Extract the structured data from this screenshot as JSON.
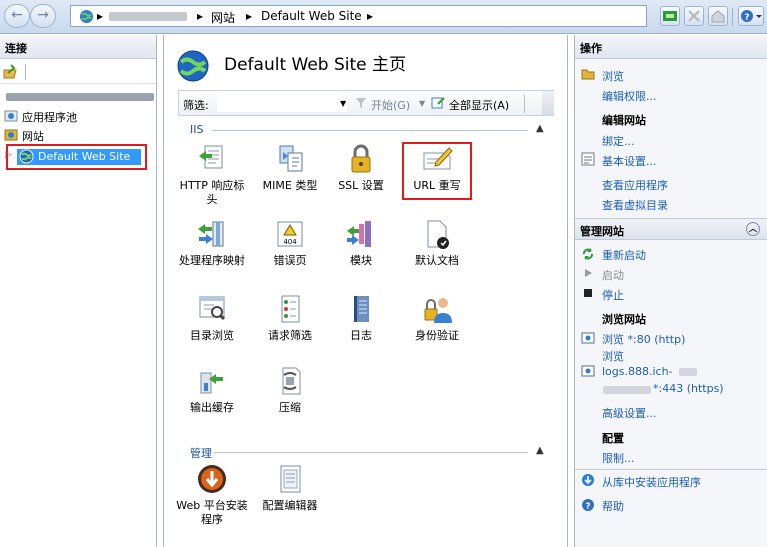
{
  "topbar": {
    "back": "←",
    "forward": "→",
    "breadcrumb": [
      {
        "label": "网站"
      },
      {
        "label": "Default Web Site"
      }
    ],
    "sep": "▸",
    "help_label": "?"
  },
  "left": {
    "header": "连接",
    "tree": {
      "app_pools": "应用程序池",
      "sites": "网站",
      "default_site": "Default Web Site"
    }
  },
  "center": {
    "title": "Default Web Site 主页",
    "filter": {
      "label": "筛选:",
      "placeholder": "",
      "go": "开始(G)",
      "show_all": "全部显示(A)"
    },
    "groups": [
      {
        "title": "IIS",
        "features": [
          {
            "label": "HTTP 响应标头",
            "icon": "http-headers-icon"
          },
          {
            "label": "MIME 类型",
            "icon": "mime-types-icon"
          },
          {
            "label": "SSL 设置",
            "icon": "lock-icon"
          },
          {
            "label": "URL 重写",
            "icon": "url-rewrite-icon"
          },
          {
            "label": "处理程序映射",
            "icon": "handler-mappings-icon"
          },
          {
            "label": "错误页",
            "icon": "error-pages-icon"
          },
          {
            "label": "模块",
            "icon": "modules-icon"
          },
          {
            "label": "默认文档",
            "icon": "default-document-icon"
          },
          {
            "label": "目录浏览",
            "icon": "directory-browsing-icon"
          },
          {
            "label": "请求筛选",
            "icon": "request-filtering-icon"
          },
          {
            "label": "日志",
            "icon": "logging-icon"
          },
          {
            "label": "身份验证",
            "icon": "authentication-icon"
          },
          {
            "label": "输出缓存",
            "icon": "output-caching-icon"
          },
          {
            "label": "压缩",
            "icon": "compression-icon"
          }
        ]
      },
      {
        "title": "管理",
        "features": [
          {
            "label": "Web 平台安装程序",
            "icon": "web-platform-installer-icon"
          },
          {
            "label": "配置编辑器",
            "icon": "configuration-editor-icon"
          }
        ]
      }
    ]
  },
  "right": {
    "header": "操作",
    "explore": "浏览",
    "edit_permissions": "编辑权限...",
    "edit_site": "编辑网站",
    "bindings": "绑定...",
    "basic_settings": "基本设置...",
    "view_apps": "查看应用程序",
    "view_vdirs": "查看虚拟目录",
    "manage_site": "管理网站",
    "restart": "重新启动",
    "start": "启动",
    "stop": "停止",
    "browse_site": "浏览网站",
    "browse_80": "浏览 *:80 (http)",
    "browse_443_line1": "浏览",
    "browse_443_line2": "logs.888.ich-",
    "browse_443_line3": "*:443 (https)",
    "advanced": "高级设置...",
    "config": "配置",
    "limits": "限制...",
    "install_gallery": "从库中安装应用程序",
    "help": "帮助"
  },
  "colors": {
    "selection": "#3399ff",
    "highlight_box": "#e01b1b",
    "link": "#1c5fb4"
  }
}
